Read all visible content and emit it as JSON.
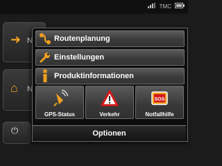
{
  "status_bar": {
    "tmc_label": "TMC",
    "icons": [
      "signal-icon",
      "tmc-icon",
      "battery-icon"
    ]
  },
  "options_menu": {
    "items": [
      {
        "label": "Routenplanung",
        "icon": "route-icon"
      },
      {
        "label": "Einstellungen",
        "icon": "wrench-icon"
      },
      {
        "label": "Produktinformationen",
        "icon": "info-icon"
      }
    ],
    "tiles": [
      {
        "label": "GPS-Status",
        "icon": "satellite-icon"
      },
      {
        "label": "Verkehr",
        "icon": "warning-triangle-icon"
      },
      {
        "label": "Notfallhilfe",
        "icon": "sos-icon",
        "sos_text": "SOS"
      }
    ],
    "footer_label": "Optionen"
  },
  "background": {
    "peek_text": "N",
    "peek_text_2": "N"
  },
  "colors": {
    "accent_orange": "#f0a020",
    "menu_gradient_top": "#5c5c5c",
    "menu_gradient_bottom": "#333333",
    "panel_bg": "#0d0d0d"
  }
}
